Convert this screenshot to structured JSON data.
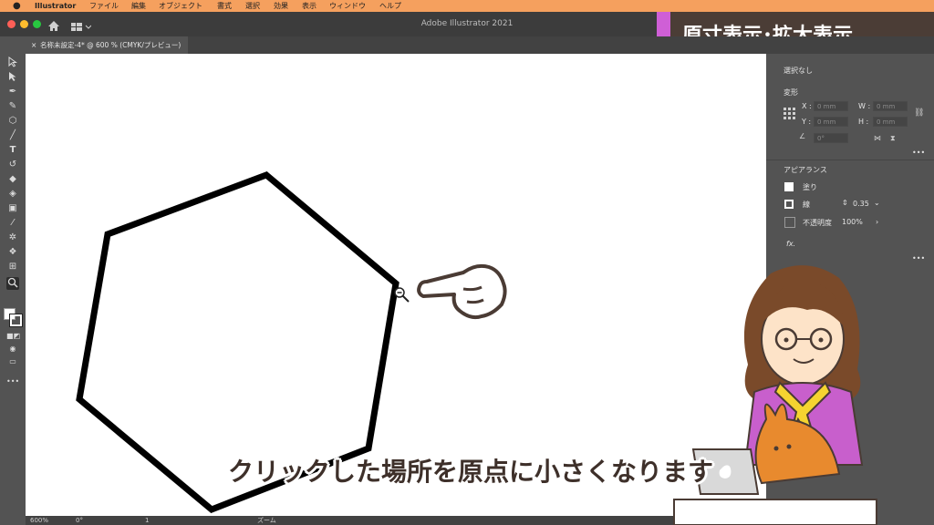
{
  "menubar": {
    "apple": "",
    "app_name": "Illustrator",
    "items": [
      "ファイル",
      "編集",
      "オブジェクト",
      "書式",
      "選択",
      "効果",
      "表示",
      "ウィンドウ",
      "ヘルプ"
    ]
  },
  "window": {
    "title": "Adobe Illustrator 2021"
  },
  "document_tab": {
    "close": "×",
    "label": "名称未設定-4* @ 600 % (CMYK/プレビュー)"
  },
  "panel": {
    "selection": "選択なし",
    "transform": {
      "title": "変形",
      "x_label": "X :",
      "x_value": "0 mm",
      "y_label": "Y :",
      "y_value": "0 mm",
      "w_label": "W :",
      "w_value": "0 mm",
      "h_label": "H :",
      "h_value": "0 mm",
      "angle_value": "0°"
    },
    "appearance": {
      "title": "アピアランス",
      "fill_label": "塗り",
      "stroke_label": "線",
      "stroke_value": "0.35",
      "opacity_label": "不透明度",
      "opacity_value": "100%",
      "fx_label": "fx."
    },
    "more": "•••"
  },
  "status": {
    "zoom": "600%",
    "angle": "0°",
    "page": "1",
    "tool": "ズーム"
  },
  "overlay": {
    "caption": "原寸表示･拡大表示",
    "subtitle": "クリックした場所を原点に小さくなります"
  },
  "colors": {
    "menubar": "#f5a05e",
    "caption_bg": "#4b3d36",
    "caption_accent": "#cf5fd6",
    "ui_gray": "#535353"
  },
  "icons": [
    "apple-icon",
    "home-icon",
    "workspace-icon",
    "zoom-out-cursor-icon",
    "pointing-hand-icon",
    "laptop-icon"
  ]
}
